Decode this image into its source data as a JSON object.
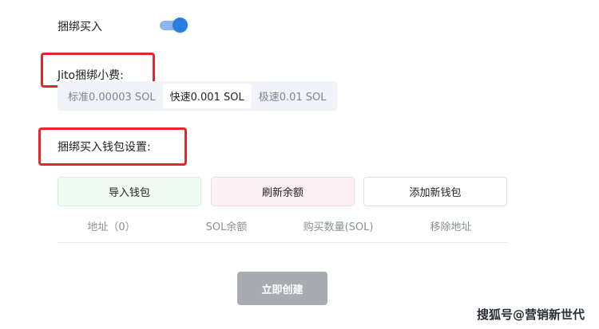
{
  "bundle_buy": {
    "label": "捆绑买入",
    "enabled": true
  },
  "jito_tip": {
    "label": "Jito捆绑小费:",
    "options": [
      "标准0.00003 SOL",
      "快速0.001 SOL",
      "极速0.01 SOL"
    ],
    "selected": "快速0.001 SOL"
  },
  "wallet_settings": {
    "label": "捆绑买入钱包设置:"
  },
  "buttons": {
    "import": "导入钱包",
    "refresh": "刷新余额",
    "add": "添加新钱包"
  },
  "table": {
    "headers": [
      "地址（0）",
      "SOL余额",
      "购买数量(SOL)",
      "移除地址"
    ]
  },
  "create_label": "立即创建",
  "watermark": "搜狐号@营销新世代",
  "colors": {
    "annotation_red": "#e8252b",
    "toggle_blue": "#2a7de1"
  }
}
